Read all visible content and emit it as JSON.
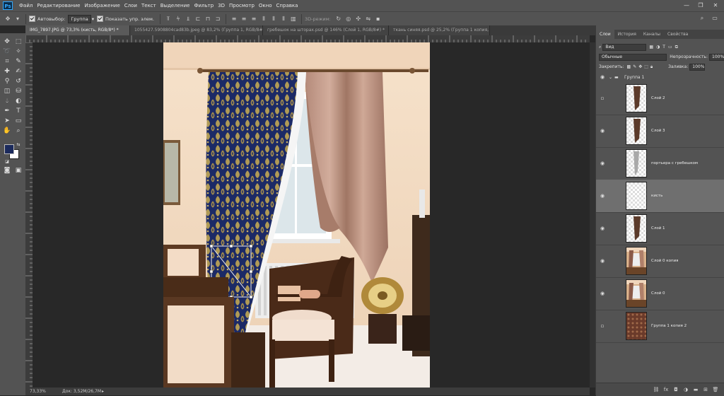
{
  "menu": [
    "Файл",
    "Редактирование",
    "Изображение",
    "Слои",
    "Текст",
    "Выделение",
    "Фильтр",
    "3D",
    "Просмотр",
    "Окно",
    "Справка"
  ],
  "app_logo": "Ps",
  "window_controls": [
    "—",
    "❐",
    "✕"
  ],
  "options": {
    "autoselect_label": "Автовыбор:",
    "autoselect_value": "Группа",
    "transform_label": "Показать упр. элем.",
    "mode_3d_label": "3D-режим:"
  },
  "tabs": [
    {
      "label": "IMG_7897.JPG @ 73,3% (кисть, RGB/8*) *",
      "active": true
    },
    {
      "label": "1055427.5908804cad83b.jpeg @ 83,2% (Группа 1, RGB/8#) *",
      "active": false
    },
    {
      "label": "гребешок на шторах.psd @ 146% (Слой 1, RGB/8#) *",
      "active": false
    },
    {
      "label": "ткань синяя.psd @ 25,2% (Группа 1 копия, RGB/8) *",
      "active": false
    }
  ],
  "status": {
    "zoom": "73,33%",
    "doc": "Док: 3,52M/26,7M"
  },
  "panel": {
    "tabs": [
      {
        "label": "Слои",
        "active": true
      },
      {
        "label": "История",
        "active": false
      },
      {
        "label": "Каналы",
        "active": false
      },
      {
        "label": "Свойства",
        "active": false
      }
    ],
    "filter_value": "Вид",
    "blend_mode": "Обычные",
    "opacity_label": "Непрозрачность:",
    "opacity_value": "100%",
    "lock_label": "Закрепить:",
    "fill_label": "Заливка:",
    "fill_value": "100%",
    "group_name": "Группа 1",
    "layers": [
      {
        "name": "Слой 2",
        "visible": false,
        "selected": false,
        "thumb": "dark-strip"
      },
      {
        "name": "Слой 3",
        "visible": true,
        "selected": false,
        "thumb": "dark-strip"
      },
      {
        "name": "портьера с гребешком",
        "visible": true,
        "selected": false,
        "thumb": "light-strip"
      },
      {
        "name": "кисть",
        "visible": true,
        "selected": true,
        "thumb": "empty"
      },
      {
        "name": "Слой 1",
        "visible": true,
        "selected": false,
        "thumb": "dark-strip"
      },
      {
        "name": "Слой 0 копия",
        "visible": true,
        "selected": false,
        "thumb": "room"
      },
      {
        "name": "Слой 0",
        "visible": true,
        "selected": false,
        "thumb": "room"
      },
      {
        "name": "Группа 1 копия 2",
        "visible": false,
        "selected": false,
        "thumb": "fabric"
      }
    ],
    "footer_icons": [
      "link-icon",
      "fx-icon",
      "mask-icon",
      "adjustment-icon",
      "folder-icon",
      "new-layer-icon",
      "trash-icon"
    ]
  },
  "colors": {
    "foreground": "#1b2a5c",
    "background": "#ffffff",
    "app_bg": "#535353",
    "canvas_bg": "#282828",
    "accent": "#31a8ff"
  }
}
